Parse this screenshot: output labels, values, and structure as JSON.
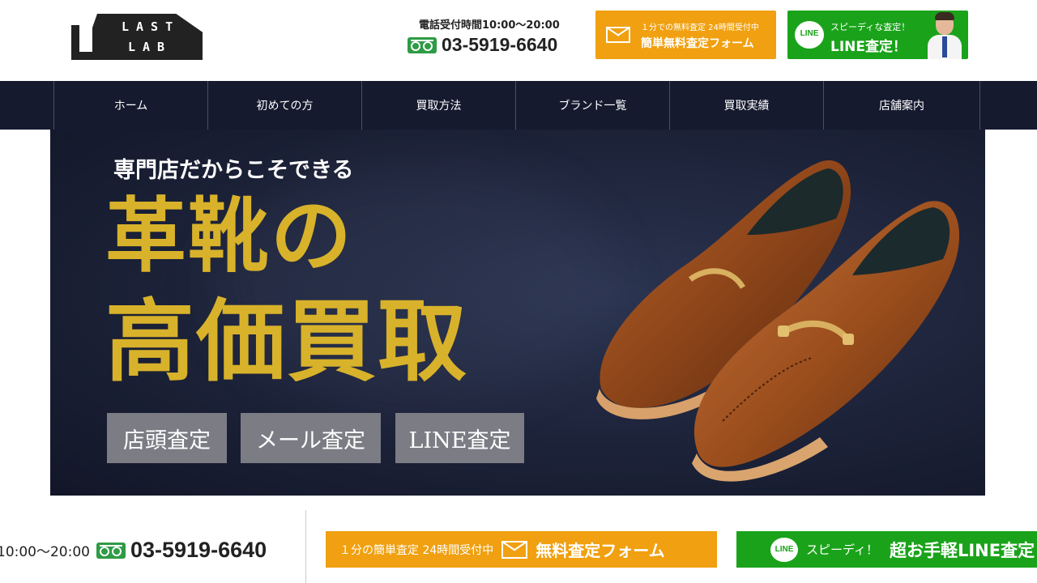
{
  "header": {
    "logo_line1": "LAST",
    "logo_line2": "LAB",
    "tel_hours": "電話受付時間10:00〜20:00",
    "tel_number": "03-5919-6640",
    "mail_button": {
      "small": "１分での無料査定 24時間受付中",
      "big": "簡単無料査定フォーム",
      "icon": "mail-icon"
    },
    "line_button": {
      "small": "スピーディな査定！",
      "big": "LINE査定！",
      "icon_text": "LINE"
    }
  },
  "nav": {
    "items": [
      {
        "label": "ホーム"
      },
      {
        "label": "初めての方"
      },
      {
        "label": "買取方法"
      },
      {
        "label": "ブランド一覧"
      },
      {
        "label": "買取実績"
      },
      {
        "label": "店舗案内"
      }
    ]
  },
  "hero": {
    "subtitle": "専門店だからこそできる",
    "title_line1": "革靴の",
    "title_line2": "高価買取",
    "badges": [
      "店頭査定",
      "メール査定",
      "LINE査定"
    ]
  },
  "bottombar": {
    "tel_hours": "10:00〜20:00",
    "tel_number": "03-5919-6640",
    "mail_small": "１分の簡単査定 24時間受付中",
    "mail_big": "無料査定フォーム",
    "line_icon_text": "LINE",
    "line_small": "スピーディ！",
    "line_big": "超お手軽LINE査定"
  },
  "colors": {
    "nav_bg": "#151a2f",
    "accent_orange": "#f0a010",
    "line_green": "#1aa31a",
    "title_gold": "#d8b22a",
    "badge_gray": "#7b7c84"
  }
}
